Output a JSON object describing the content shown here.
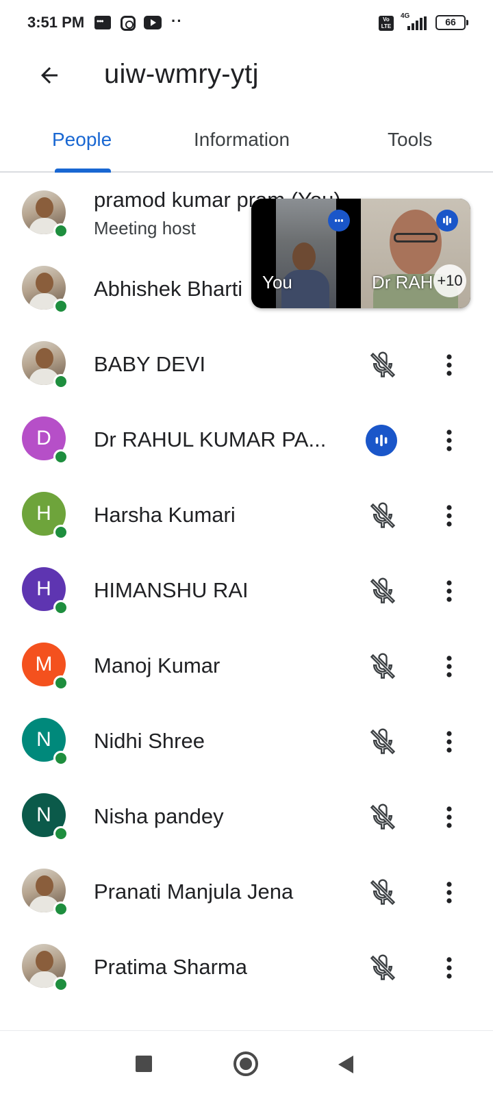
{
  "status_bar": {
    "time": "3:51 PM",
    "network": "4G",
    "volte": "Vo LTE",
    "battery": "66"
  },
  "header": {
    "back_icon": "arrow-back-icon",
    "meeting_code": "uiw-wmry-ytj"
  },
  "tabs": [
    {
      "label": "People",
      "active": true
    },
    {
      "label": "Information",
      "active": false
    },
    {
      "label": "Tools",
      "active": false
    }
  ],
  "pip": {
    "tiles": [
      {
        "label": "You",
        "speaking": true
      },
      {
        "label": "Dr RAH",
        "speaking": true
      }
    ],
    "more_count": "+10"
  },
  "participants": [
    {
      "name": "pramod kumar pram (You)",
      "subtext": "Meeting host",
      "avatar": "photo",
      "mic": "hidden"
    },
    {
      "name": "Abhishek Bharti",
      "avatar": "photo",
      "mic": "hidden"
    },
    {
      "name": "BABY DEVI",
      "avatar": "photo",
      "mic": "muted"
    },
    {
      "name": "Dr RAHUL KUMAR PA...",
      "avatar": "letter",
      "letter": "D",
      "color": "#b64fc8",
      "mic": "speaking"
    },
    {
      "name": "Harsha Kumari",
      "avatar": "letter",
      "letter": "H",
      "color": "#6ea43b",
      "mic": "muted"
    },
    {
      "name": "HIMANSHU RAI",
      "avatar": "letter",
      "letter": "H",
      "color": "#5e35b1",
      "mic": "muted"
    },
    {
      "name": "Manoj Kumar",
      "avatar": "letter",
      "letter": "M",
      "color": "#f4511e",
      "mic": "muted"
    },
    {
      "name": "Nidhi Shree",
      "avatar": "letter",
      "letter": "N",
      "color": "#00897b",
      "mic": "muted"
    },
    {
      "name": "Nisha pandey",
      "avatar": "letter",
      "letter": "N",
      "color": "#0b5a4a",
      "mic": "muted"
    },
    {
      "name": "Pranati Manjula Jena",
      "avatar": "photo",
      "mic": "muted"
    },
    {
      "name": "Pratima Sharma",
      "avatar": "photo",
      "mic": "muted"
    }
  ],
  "colors": {
    "accent": "#1967d2",
    "presence": "#1e8e3e",
    "speaking": "#1a56c9"
  }
}
